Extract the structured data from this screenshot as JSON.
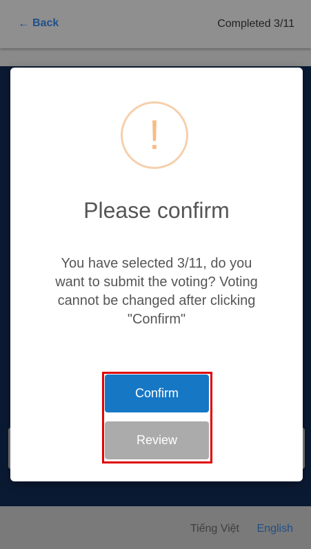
{
  "header": {
    "back_label": "Back",
    "back_icon": "arrow-left-icon",
    "progress": "Completed 3/11"
  },
  "modal": {
    "icon": "exclamation-icon",
    "icon_glyph": "!",
    "title": "Please confirm",
    "message": "You have selected 3/11, do you want to submit the voting? Voting cannot be changed after clicking \"Confirm\"",
    "confirm_label": "Confirm",
    "review_label": "Review"
  },
  "footer": {
    "lang_vi": "Tiếng Việt",
    "lang_en": "English"
  },
  "colors": {
    "accent": "#1677c5",
    "review_button": "#ababab",
    "warning": "#f8bb86",
    "highlight": "#e00000"
  }
}
